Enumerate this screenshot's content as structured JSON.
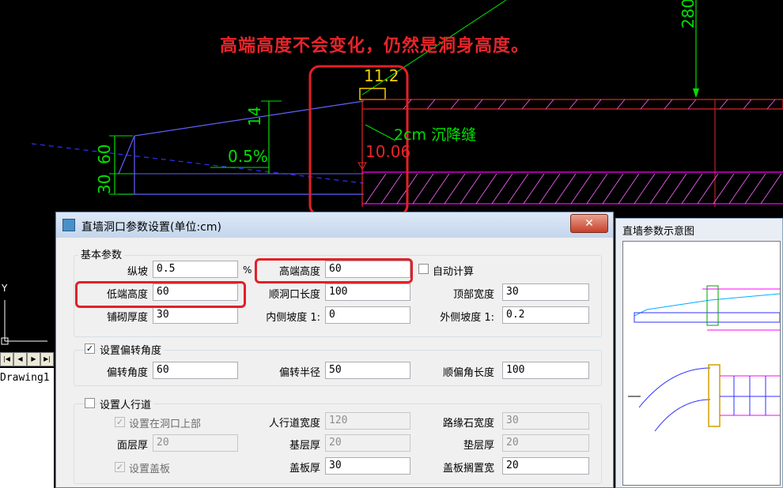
{
  "cad": {
    "annotation": "高端高度不会变化，仍然是洞身高度。",
    "dims": {
      "d112": "11.2",
      "d14": "14",
      "d60": "60",
      "d30": "30",
      "d05": "0.5%",
      "d1006": "10.06",
      "d2cm": "2cm 沉降缝",
      "d280": "280"
    },
    "ucs_y": "Y",
    "tab_buttons": [
      "|◀",
      "◀",
      "▶",
      "▶|"
    ],
    "model_tab": "Drawing1"
  },
  "dialog": {
    "title": "直墙洞口参数设置(单位:cm)",
    "close_label": "✕",
    "basic": {
      "group_title": "基本参数",
      "slope_label": "纵坡",
      "slope_value": "0.5",
      "slope_unit": "%",
      "high_label": "高端高度",
      "high_value": "60",
      "auto_label": "自动计算",
      "auto_checked": false,
      "low_label": "低端高度",
      "low_value": "60",
      "length_label": "顺洞口长度",
      "length_value": "100",
      "top_label": "顶部宽度",
      "top_value": "30",
      "pave_label": "铺砌厚度",
      "pave_value": "30",
      "inner_label": "内侧坡度 1:",
      "inner_value": "0",
      "outer_label": "外侧坡度 1:",
      "outer_value": "0.2"
    },
    "rotation": {
      "group_title": "设置偏转角度",
      "checked": true,
      "angle_label": "偏转角度",
      "angle_value": "60",
      "radius_label": "偏转半径",
      "radius_value": "50",
      "len_label": "顺偏角长度",
      "len_value": "100"
    },
    "sidewalk": {
      "group_title": "设置人行道",
      "checked": false,
      "top_cb_label": "设置在洞口上部",
      "top_cb_checked": true,
      "width_label": "人行道宽度",
      "width_value": "120",
      "curb_label": "路缘石宽度",
      "curb_value": "30",
      "surface_label": "面层厚",
      "surface_value": "20",
      "base_label": "基层厚",
      "base_value": "20",
      "cushion_label": "垫层厚",
      "cushion_value": "20",
      "cover_cb_label": "设置盖板",
      "cover_cb_checked": true,
      "cover_label": "盖板厚",
      "cover_value": "30",
      "rest_label": "盖板搁置宽",
      "rest_value": "20"
    }
  },
  "preview": {
    "title": "直墙参数示意图"
  },
  "colors": {
    "annotation_red": "#e8242a",
    "cad_green": "#00e000",
    "cad_magenta": "#ff00ff",
    "cad_red": "#e8242a",
    "cad_blue": "#3030ff",
    "cad_yellow": "#f0d000",
    "highlight_red": "#e32027"
  }
}
